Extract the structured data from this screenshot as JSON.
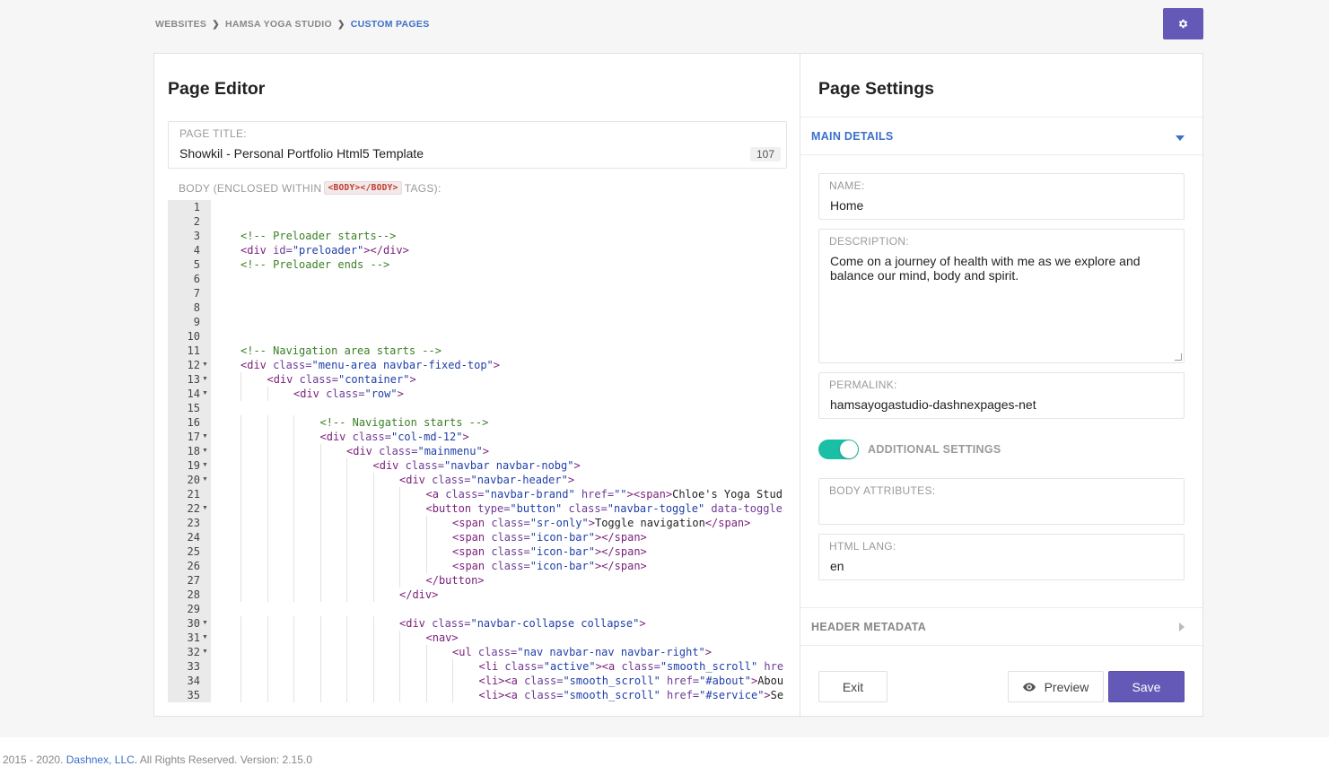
{
  "breadcrumb": {
    "items": [
      "WEBSITES",
      "HAMSA YOGA STUDIO",
      "CUSTOM PAGES"
    ]
  },
  "toolbar": {
    "settings_icon": "gear-icon"
  },
  "editor": {
    "title": "Page Editor",
    "page_title_label": "PAGE TITLE:",
    "page_title_value": "Showkil - Personal Portfolio Html5 Template",
    "page_title_count": "107",
    "body_label_prefix": "BODY (ENCLOSED WITHIN",
    "body_label_code": "<BODY></BODY>",
    "body_label_suffix": "TAGS):",
    "code_lines": [
      {
        "n": 1,
        "fold": false,
        "indent": 0,
        "tokens": []
      },
      {
        "n": 2,
        "fold": false,
        "indent": 0,
        "tokens": []
      },
      {
        "n": 3,
        "fold": false,
        "indent": 1,
        "tokens": [
          [
            "c",
            "<!-- Preloader starts-->"
          ]
        ]
      },
      {
        "n": 4,
        "fold": false,
        "indent": 1,
        "tokens": [
          [
            "t",
            "<div "
          ],
          [
            "a",
            "id="
          ],
          [
            "s",
            "\"preloader\""
          ],
          [
            "t",
            "></div>"
          ]
        ]
      },
      {
        "n": 5,
        "fold": false,
        "indent": 1,
        "tokens": [
          [
            "c",
            "<!-- Preloader ends -->"
          ]
        ]
      },
      {
        "n": 6,
        "fold": false,
        "indent": 0,
        "tokens": []
      },
      {
        "n": 7,
        "fold": false,
        "indent": 0,
        "tokens": []
      },
      {
        "n": 8,
        "fold": false,
        "indent": 0,
        "tokens": []
      },
      {
        "n": 9,
        "fold": false,
        "indent": 0,
        "tokens": []
      },
      {
        "n": 10,
        "fold": false,
        "indent": 0,
        "tokens": []
      },
      {
        "n": 11,
        "fold": false,
        "indent": 1,
        "tokens": [
          [
            "c",
            "<!-- Navigation area starts -->"
          ]
        ]
      },
      {
        "n": 12,
        "fold": true,
        "indent": 1,
        "tokens": [
          [
            "t",
            "<div "
          ],
          [
            "a",
            "class="
          ],
          [
            "s",
            "\"menu-area navbar-fixed-top\""
          ],
          [
            "t",
            ">"
          ]
        ]
      },
      {
        "n": 13,
        "fold": true,
        "indent": 2,
        "tokens": [
          [
            "t",
            "<div "
          ],
          [
            "a",
            "class="
          ],
          [
            "s",
            "\"container\""
          ],
          [
            "t",
            ">"
          ]
        ]
      },
      {
        "n": 14,
        "fold": true,
        "indent": 3,
        "tokens": [
          [
            "t",
            "<div "
          ],
          [
            "a",
            "class="
          ],
          [
            "s",
            "\"row\""
          ],
          [
            "t",
            ">"
          ]
        ]
      },
      {
        "n": 15,
        "fold": false,
        "indent": 0,
        "tokens": []
      },
      {
        "n": 16,
        "fold": false,
        "indent": 4,
        "tokens": [
          [
            "c",
            "<!-- Navigation starts -->"
          ]
        ]
      },
      {
        "n": 17,
        "fold": true,
        "indent": 4,
        "tokens": [
          [
            "t",
            "<div "
          ],
          [
            "a",
            "class="
          ],
          [
            "s",
            "\"col-md-12\""
          ],
          [
            "t",
            ">"
          ]
        ]
      },
      {
        "n": 18,
        "fold": true,
        "indent": 5,
        "tokens": [
          [
            "t",
            "<div "
          ],
          [
            "a",
            "class="
          ],
          [
            "s",
            "\"mainmenu\""
          ],
          [
            "t",
            ">"
          ]
        ]
      },
      {
        "n": 19,
        "fold": true,
        "indent": 6,
        "tokens": [
          [
            "t",
            "<div "
          ],
          [
            "a",
            "class="
          ],
          [
            "s",
            "\"navbar navbar-nobg\""
          ],
          [
            "t",
            ">"
          ]
        ]
      },
      {
        "n": 20,
        "fold": true,
        "indent": 7,
        "tokens": [
          [
            "t",
            "<div "
          ],
          [
            "a",
            "class="
          ],
          [
            "s",
            "\"navbar-header\""
          ],
          [
            "t",
            ">"
          ]
        ]
      },
      {
        "n": 21,
        "fold": false,
        "indent": 8,
        "tokens": [
          [
            "t",
            "<a "
          ],
          [
            "a",
            "class="
          ],
          [
            "s",
            "\"navbar-brand\""
          ],
          [
            "a",
            " href="
          ],
          [
            "s",
            "\"\""
          ],
          [
            "t",
            "><span>"
          ],
          [
            "x",
            "Chloe's Yoga Stud"
          ]
        ]
      },
      {
        "n": 22,
        "fold": true,
        "indent": 8,
        "tokens": [
          [
            "t",
            "<button "
          ],
          [
            "a",
            "type="
          ],
          [
            "s",
            "\"button\""
          ],
          [
            "a",
            " class="
          ],
          [
            "s",
            "\"navbar-toggle\""
          ],
          [
            "a",
            " data-toggle"
          ]
        ]
      },
      {
        "n": 23,
        "fold": false,
        "indent": 9,
        "tokens": [
          [
            "t",
            "<span "
          ],
          [
            "a",
            "class="
          ],
          [
            "s",
            "\"sr-only\""
          ],
          [
            "t",
            ">"
          ],
          [
            "x",
            "Toggle navigation"
          ],
          [
            "t",
            "</span>"
          ]
        ]
      },
      {
        "n": 24,
        "fold": false,
        "indent": 9,
        "tokens": [
          [
            "t",
            "<span "
          ],
          [
            "a",
            "class="
          ],
          [
            "s",
            "\"icon-bar\""
          ],
          [
            "t",
            "></span>"
          ]
        ]
      },
      {
        "n": 25,
        "fold": false,
        "indent": 9,
        "tokens": [
          [
            "t",
            "<span "
          ],
          [
            "a",
            "class="
          ],
          [
            "s",
            "\"icon-bar\""
          ],
          [
            "t",
            "></span>"
          ]
        ]
      },
      {
        "n": 26,
        "fold": false,
        "indent": 9,
        "tokens": [
          [
            "t",
            "<span "
          ],
          [
            "a",
            "class="
          ],
          [
            "s",
            "\"icon-bar\""
          ],
          [
            "t",
            "></span>"
          ]
        ]
      },
      {
        "n": 27,
        "fold": false,
        "indent": 8,
        "tokens": [
          [
            "t",
            "</button>"
          ]
        ]
      },
      {
        "n": 28,
        "fold": false,
        "indent": 7,
        "tokens": [
          [
            "t",
            "</div>"
          ]
        ]
      },
      {
        "n": 29,
        "fold": false,
        "indent": 0,
        "tokens": []
      },
      {
        "n": 30,
        "fold": true,
        "indent": 7,
        "tokens": [
          [
            "t",
            "<div "
          ],
          [
            "a",
            "class="
          ],
          [
            "s",
            "\"navbar-collapse collapse\""
          ],
          [
            "t",
            ">"
          ]
        ]
      },
      {
        "n": 31,
        "fold": true,
        "indent": 8,
        "tokens": [
          [
            "t",
            "<nav>"
          ]
        ]
      },
      {
        "n": 32,
        "fold": true,
        "indent": 9,
        "tokens": [
          [
            "t",
            "<ul "
          ],
          [
            "a",
            "class="
          ],
          [
            "s",
            "\"nav navbar-nav navbar-right\""
          ],
          [
            "t",
            ">"
          ]
        ]
      },
      {
        "n": 33,
        "fold": false,
        "indent": 10,
        "tokens": [
          [
            "t",
            "<li "
          ],
          [
            "a",
            "class="
          ],
          [
            "s",
            "\"active\""
          ],
          [
            "t",
            "><a "
          ],
          [
            "a",
            "class="
          ],
          [
            "s",
            "\"smooth_scroll\""
          ],
          [
            "a",
            " hre"
          ]
        ]
      },
      {
        "n": 34,
        "fold": false,
        "indent": 10,
        "tokens": [
          [
            "t",
            "<li><a "
          ],
          [
            "a",
            "class="
          ],
          [
            "s",
            "\"smooth_scroll\""
          ],
          [
            "a",
            " href="
          ],
          [
            "s",
            "\"#about\""
          ],
          [
            "t",
            ">"
          ],
          [
            "x",
            "Abou"
          ]
        ]
      },
      {
        "n": 35,
        "fold": false,
        "indent": 10,
        "tokens": [
          [
            "t",
            "<li><a "
          ],
          [
            "a",
            "class="
          ],
          [
            "s",
            "\"smooth_scroll\""
          ],
          [
            "a",
            " href="
          ],
          [
            "s",
            "\"#service\""
          ],
          [
            "t",
            ">"
          ],
          [
            "x",
            "Se"
          ]
        ]
      }
    ]
  },
  "settings": {
    "title": "Page Settings",
    "main_details_label": "MAIN DETAILS",
    "name_label": "NAME:",
    "name_value": "Home",
    "description_label": "DESCRIPTION:",
    "description_value": "Come on a journey of health with me as we explore and balance our mind, body and spirit.",
    "permalink_label": "PERMALINK:",
    "permalink_value": "hamsayogastudio-dashnexpages-net",
    "additional_settings_label": "ADDITIONAL SETTINGS",
    "additional_settings_on": true,
    "body_attributes_label": "BODY ATTRIBUTES:",
    "body_attributes_value": "",
    "html_lang_label": "HTML LANG:",
    "html_lang_value": "en",
    "header_metadata_label": "HEADER METADATA",
    "exit_label": "Exit",
    "preview_label": "Preview",
    "save_label": "Save"
  },
  "footer": {
    "prefix": "2015 - 2020.",
    "company": "Dashnex, LLC.",
    "suffix": "All Rights Reserved. Version: 2.15.0"
  },
  "colors": {
    "accent": "#6459b6",
    "link": "#3b70c9",
    "toggle": "#1bbfa6"
  }
}
